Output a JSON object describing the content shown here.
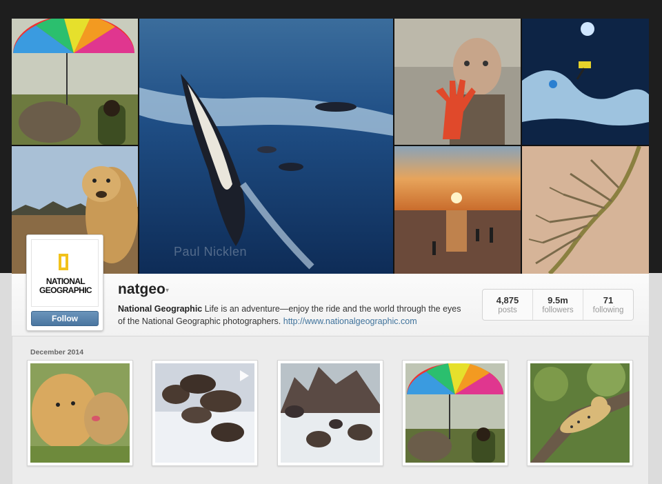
{
  "cover": {
    "photo_credit": "Paul Nicklen",
    "tiles": [
      {
        "name": "cover-tile-umbrella-rhino",
        "icon": "rhino-umbrella-photo"
      },
      {
        "name": "cover-tile-cheetah",
        "icon": "cheetah-photo"
      },
      {
        "name": "cover-tile-penguins",
        "icon": "penguin-underwater-photo"
      },
      {
        "name": "cover-tile-child-hand",
        "icon": "child-hand-photo"
      },
      {
        "name": "cover-tile-ice-climber",
        "icon": "ice-climber-photo"
      },
      {
        "name": "cover-tile-sunset",
        "icon": "sunset-beach-photo"
      },
      {
        "name": "cover-tile-river-delta",
        "icon": "river-delta-photo"
      }
    ]
  },
  "profile": {
    "logo_text_line1": "NATIONAL",
    "logo_text_line2": "GEOGRAPHIC",
    "follow_label": "Follow",
    "username": "natgeo",
    "username_caret": "▾",
    "bio_name": "National Geographic",
    "bio_text": " Life is an adventure—enjoy the ride and the world through the eyes of the National Geographic photographers. ",
    "bio_link": "http://www.nationalgeographic.com",
    "stats": [
      {
        "value": "4,875",
        "label": "posts"
      },
      {
        "value": "9.5m",
        "label": "followers"
      },
      {
        "value": "71",
        "label": "following"
      }
    ]
  },
  "feed": {
    "date_label": "December 2014",
    "thumbs": [
      {
        "name": "feed-thumb-cheetahs",
        "icon": "cheetah-cubs-photo",
        "video": false
      },
      {
        "name": "feed-thumb-otters",
        "icon": "otters-snow-photo",
        "video": true
      },
      {
        "name": "feed-thumb-seals",
        "icon": "seals-shipwreck-photo",
        "video": false
      },
      {
        "name": "feed-thumb-umbrella",
        "icon": "rhino-umbrella-photo",
        "video": false
      },
      {
        "name": "feed-thumb-leopard",
        "icon": "leopard-tree-photo",
        "video": false
      }
    ]
  },
  "colors": {
    "accent_link": "#3f729b",
    "follow_button": "#4a76a0",
    "logo_yellow": "#f2c21b"
  }
}
